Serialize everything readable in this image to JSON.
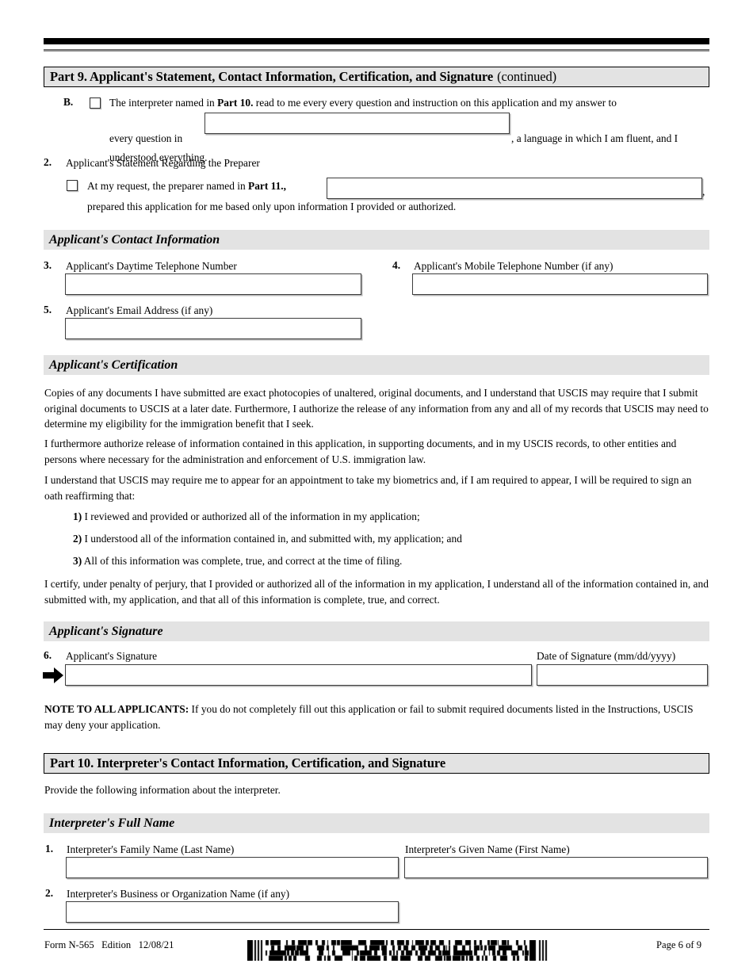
{
  "document": {
    "form_number": "Form N-565",
    "edition_label": "Edition",
    "edition_date": "12/08/21",
    "page_label": "Page 6 of 9",
    "barcode_alt": "pdf417-barcode"
  },
  "part9": {
    "title": "Part 9.  Applicant's Statement, Contact Information, Certification, and Signature",
    "continued": "(continued)",
    "item_b": {
      "letter": "B.",
      "line1_pre": "The interpreter named in ",
      "line1_bold": "Part 10.",
      "line1_post": " read to me every every question and instruction on this application and my answer to",
      "line2_pre": "every question in",
      "line2_post": ", a language in which I am fluent, and I",
      "line3": "understood everything."
    },
    "item_2": {
      "number": "2.",
      "label": "Applicant's Statement Regarding the Preparer",
      "line1_pre": "At my request, the preparer named in ",
      "line1_bold": "Part 11.,",
      "line1_comma": ",",
      "line2": "prepared this application for me based only upon information I provided or authorized."
    },
    "contact_section": {
      "heading": "Applicant's Contact Information",
      "fields": [
        {
          "number": "3.",
          "label": "Applicant's Daytime Telephone Number",
          "value": ""
        },
        {
          "number": "4.",
          "label": "Applicant's Mobile Telephone Number (if any)",
          "value": ""
        },
        {
          "number": "5.",
          "label": "Applicant's Email Address (if any)",
          "value": ""
        }
      ]
    },
    "certification_section": {
      "heading": "Applicant's Certification",
      "paragraph1": "Copies of any documents I have submitted are exact photocopies of unaltered, original documents, and I understand that USCIS may require that I submit original documents to USCIS at a later date.  Furthermore, I authorize the release of any information from any and all of my records that USCIS may need to determine my eligibility for the immigration benefit that I seek.",
      "paragraph2": "I furthermore authorize release of information contained in this application, in supporting documents, and in my USCIS records, to other entities and persons where necessary for the administration and enforcement of U.S. immigration law.",
      "paragraph3": "I understand that USCIS may require me to appear for an appointment to take my biometrics and, if I am required to appear, I will be required to sign an oath reaffirming that:",
      "list": [
        {
          "marker": "1)",
          "text": " I reviewed and provided or authorized all of the information in my application;"
        },
        {
          "marker": "2)",
          "text": " I understood all of the information contained in, and submitted with, my application; and"
        },
        {
          "marker": "3)",
          "text": " All of this information was complete, true, and correct at the time of filing."
        }
      ],
      "paragraph4": "I certify, under penalty of perjury, that I provided or authorized all of the information in my application, I understand all of the information contained in, and submitted with, my application, and that all of this information is complete, true, and correct."
    },
    "signature_section": {
      "heading": "Applicant's Signature",
      "number": "6.",
      "signature_label": "Applicant's Signature",
      "signature_value": "",
      "date_label": "Date of Signature (mm/dd/yyyy)",
      "date_value": ""
    },
    "note": {
      "bold": "NOTE TO ALL APPLICANTS:",
      "text": "  If you do not completely fill out this application or fail to submit required documents listed in the Instructions, USCIS may deny your application."
    }
  },
  "part10": {
    "title": "Part 10.  Interpreter's Contact Information, Certification, and Signature",
    "intro": "Provide the following information about the interpreter.",
    "name_section": {
      "heading": "Interpreter's Full Name",
      "item1_number": "1.",
      "family_label": "Interpreter's Family Name (Last Name)",
      "family_value": "",
      "given_label": "Interpreter's Given Name (First Name)",
      "given_value": "",
      "item2_number": "2.",
      "business_label": "Interpreter's Business or Organization Name (if any)",
      "business_value": ""
    }
  }
}
